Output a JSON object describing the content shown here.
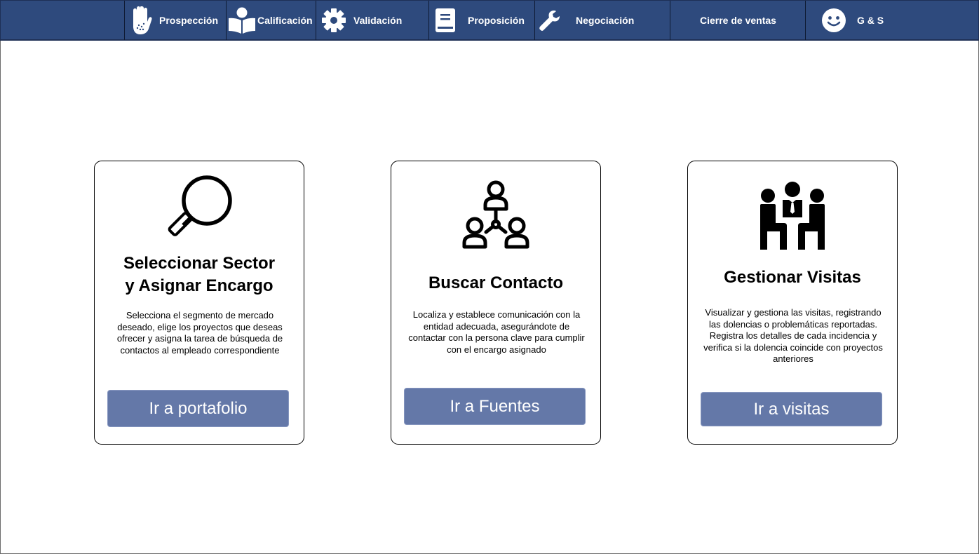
{
  "nav": {
    "items": [
      {
        "key": "prospeccion",
        "label": "Prospección",
        "icon": "hand-icon"
      },
      {
        "key": "calificacion",
        "label": "Calificación",
        "icon": "person-reading-icon"
      },
      {
        "key": "validacion",
        "label": "Validación",
        "icon": "gear-icon"
      },
      {
        "key": "proposicion",
        "label": "Proposición",
        "icon": "document-icon"
      },
      {
        "key": "negociacion",
        "label": "Negociación",
        "icon": "wrench-icon"
      },
      {
        "key": "cierre",
        "label": "Cierre de ventas",
        "icon": ""
      },
      {
        "key": "brand",
        "label": "G & S",
        "icon": "smiley-icon"
      }
    ]
  },
  "cards": [
    {
      "title_line1": "Seleccionar Sector",
      "title_line2": "y Asignar Encargo",
      "description": "Selecciona el segmento de mercado deseado, elige los proyectos que deseas ofrecer y asigna la tarea de búsqueda de contactos al empleado correspondiente",
      "button": "Ir a portafolio",
      "icon": "magnifier-icon"
    },
    {
      "title": "Buscar Contacto",
      "description": "Localiza y establece comunicación con la entidad adecuada, asegurándote de contactar con la persona clave para cumplir con el encargo asignado",
      "button": "Ir a Fuentes",
      "icon": "network-people-icon"
    },
    {
      "title": "Gestionar Visitas",
      "description": "Visualizar y gestiona las visitas, registrando las dolencias o problemáticas reportadas. Registra los detalles de cada incidencia y verifica si la dolencia coincide con proyectos anteriores",
      "button": "Ir a visitas",
      "icon": "meeting-icon"
    }
  ],
  "colors": {
    "nav_bg": "#2e4a7d",
    "button_bg": "#6478a8"
  }
}
